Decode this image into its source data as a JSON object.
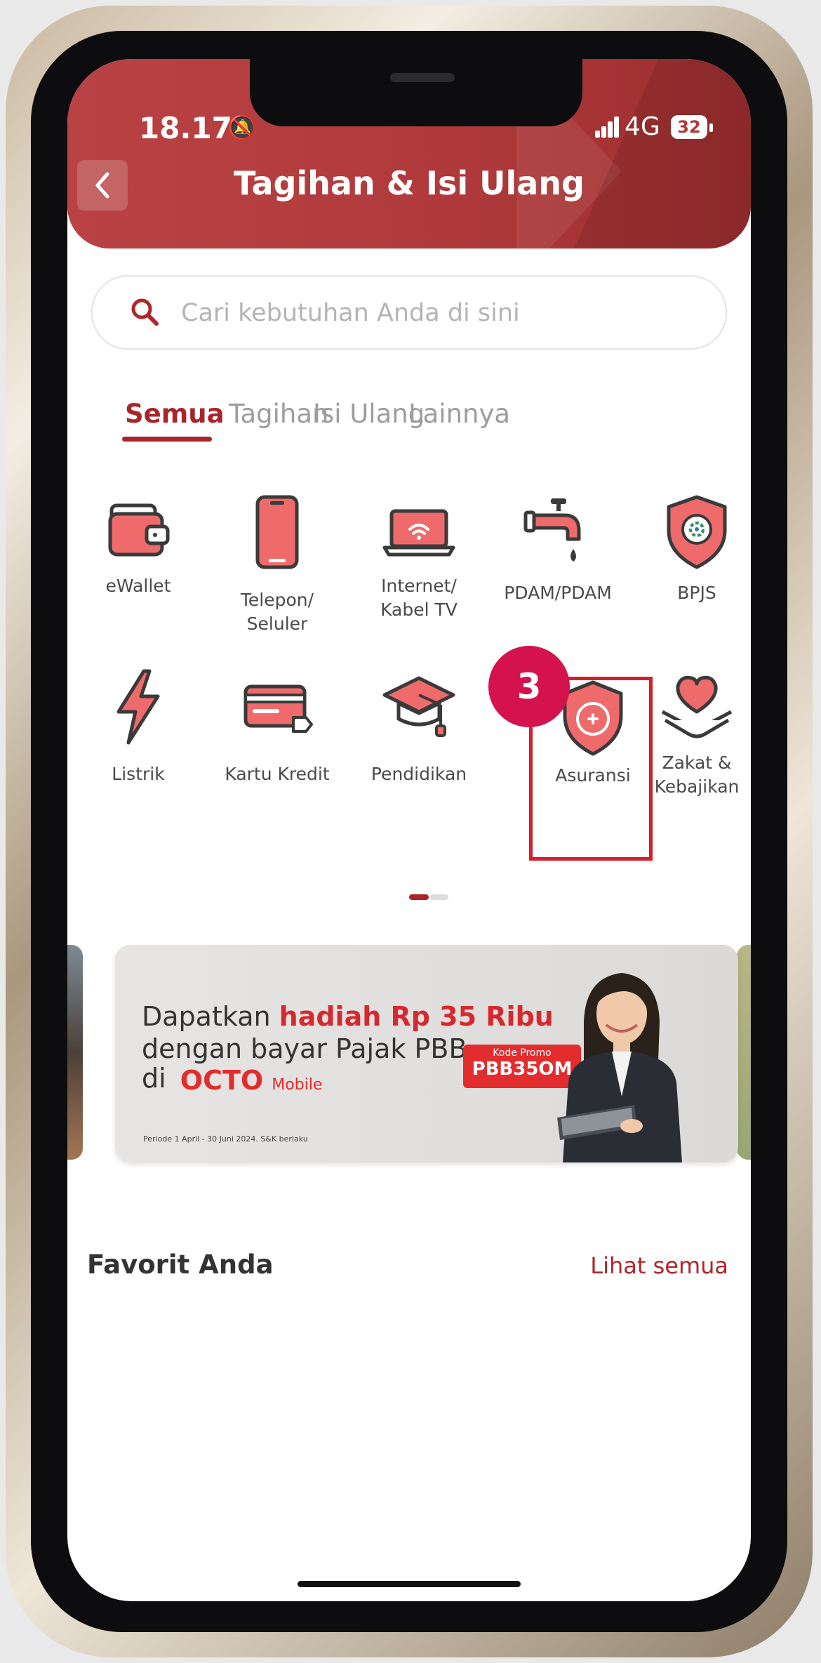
{
  "status": {
    "time": "18.17",
    "network": "4G",
    "battery": "32"
  },
  "header": {
    "title": "Tagihan & Isi Ulang"
  },
  "search": {
    "placeholder": "Cari kebutuhan Anda di sini"
  },
  "tabs": [
    {
      "label": "Semua",
      "active": true
    },
    {
      "label": "Tagihan",
      "active": false
    },
    {
      "label": "Isi Ulang",
      "active": false
    },
    {
      "label": "Lainnya",
      "active": false
    }
  ],
  "categories": [
    {
      "label": "eWallet",
      "icon": "wallet-icon"
    },
    {
      "label": "Telepon/\nSeluler",
      "icon": "phone-icon"
    },
    {
      "label": "Internet/\nKabel TV",
      "icon": "laptop-wifi-icon"
    },
    {
      "label": "PDAM/PDAM",
      "icon": "water-tap-icon"
    },
    {
      "label": "BPJS",
      "icon": "bpjs-shield-icon"
    },
    {
      "label": "Listrik",
      "icon": "lightning-icon"
    },
    {
      "label": "Kartu Kredit",
      "icon": "credit-card-icon"
    },
    {
      "label": "Pendidikan",
      "icon": "graduation-cap-icon"
    },
    {
      "label": "Asuransi",
      "icon": "insurance-shield-icon"
    },
    {
      "label": "Zakat &\nKebajikan",
      "icon": "heart-hands-icon"
    }
  ],
  "step_badge": "3",
  "banner": {
    "line1_prefix": "Dapatkan ",
    "line1_highlight": "hadiah Rp 35 Ribu",
    "line2": "dengan bayar Pajak PBB",
    "line3_prefix": "di",
    "brand": "OCTO",
    "brand_suffix": "Mobile",
    "promo_label": "Kode Promo",
    "promo_code": "PBB35OM",
    "period": "Periode 1 April - 30 Juni 2024. S&K berlaku"
  },
  "favorites": {
    "title": "Favorit Anda",
    "see_all": "Lihat semua"
  },
  "colors": {
    "brand_red": "#b03a3b",
    "accent_red": "#a8262a",
    "icon_fill": "#ef6b6b",
    "badge": "#d4134e"
  }
}
